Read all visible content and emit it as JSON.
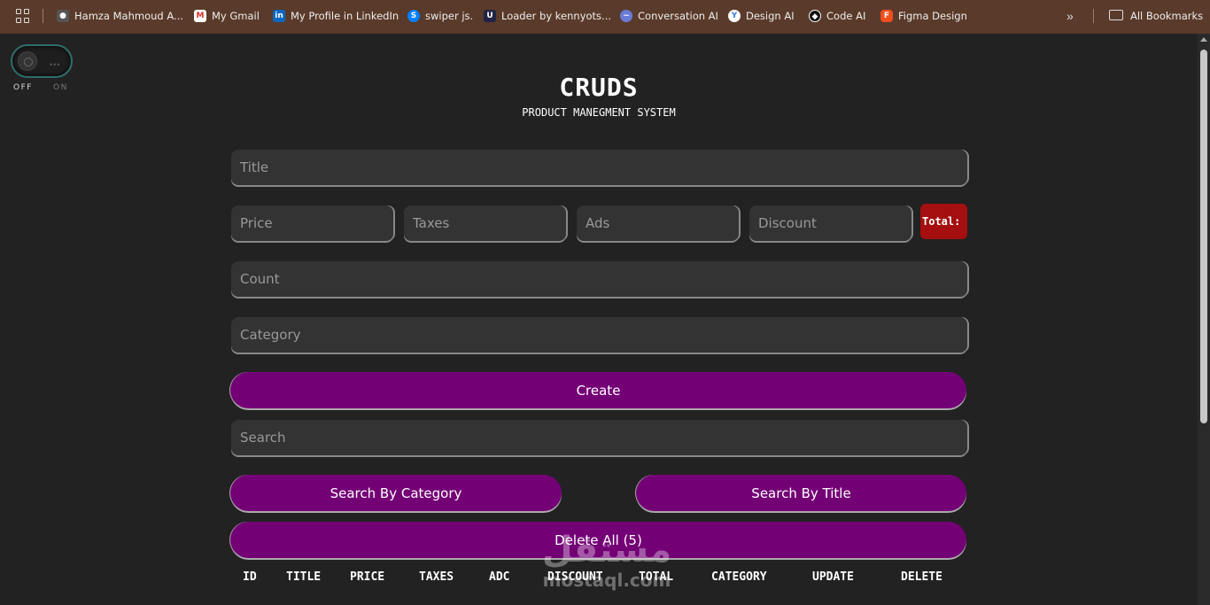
{
  "bookmarks": {
    "items": [
      {
        "label": "Hamza Mahmoud A...",
        "icon": "profile-photo-icon",
        "color": "#555555"
      },
      {
        "label": "My Gmail",
        "icon": "gmail-icon",
        "color": "#d93025"
      },
      {
        "label": "My Profile in LinkedIn",
        "icon": "linkedin-icon",
        "color": "#0a66c2"
      },
      {
        "label": "swiper js.",
        "icon": "swiper-icon",
        "color": "#0080ff"
      },
      {
        "label": "Loader by kennyots...",
        "icon": "uiverse-icon",
        "color": "#222244"
      },
      {
        "label": "Conversation AI",
        "icon": "conversation-ai-icon",
        "color": "#6a7bd8"
      },
      {
        "label": "Design AI",
        "icon": "design-ai-icon",
        "color": "#3a7bd5"
      },
      {
        "label": "Code AI",
        "icon": "code-ai-icon",
        "color": "#111111"
      },
      {
        "label": "Figma Design",
        "icon": "figma-icon",
        "color": "#f24e1e"
      }
    ],
    "all_bookmarks": "All Bookmarks"
  },
  "toggle": {
    "off": "OFF",
    "on": "ON"
  },
  "header": {
    "title": "CRUDS",
    "subtitle": "PRODUCT MANEGMENT SYSTEM"
  },
  "form": {
    "title_placeholder": "Title",
    "price_placeholder": "Price",
    "taxes_placeholder": "Taxes",
    "ads_placeholder": "Ads",
    "discount_placeholder": "Discount",
    "total_label": "Total:",
    "count_placeholder": "Count",
    "category_placeholder": "Category",
    "create_label": "Create",
    "search_placeholder": "Search",
    "search_by_category": "Search By Category",
    "search_by_title": "Search By Title",
    "delete_all": "Delete All (5)"
  },
  "table": {
    "columns": [
      "ID",
      "TITLE",
      "PRICE",
      "TAXES",
      "ADC",
      "DISCOUNT",
      "TOTAL",
      "CATEGORY",
      "UPDATE",
      "DELETE"
    ]
  },
  "watermark": {
    "arabic": "مستقل",
    "latin": "mostaql.com"
  },
  "colors": {
    "accent": "#740076",
    "total": "#a50f0f",
    "background": "#222222",
    "bookmarks_bar": "#5a3a2a"
  }
}
